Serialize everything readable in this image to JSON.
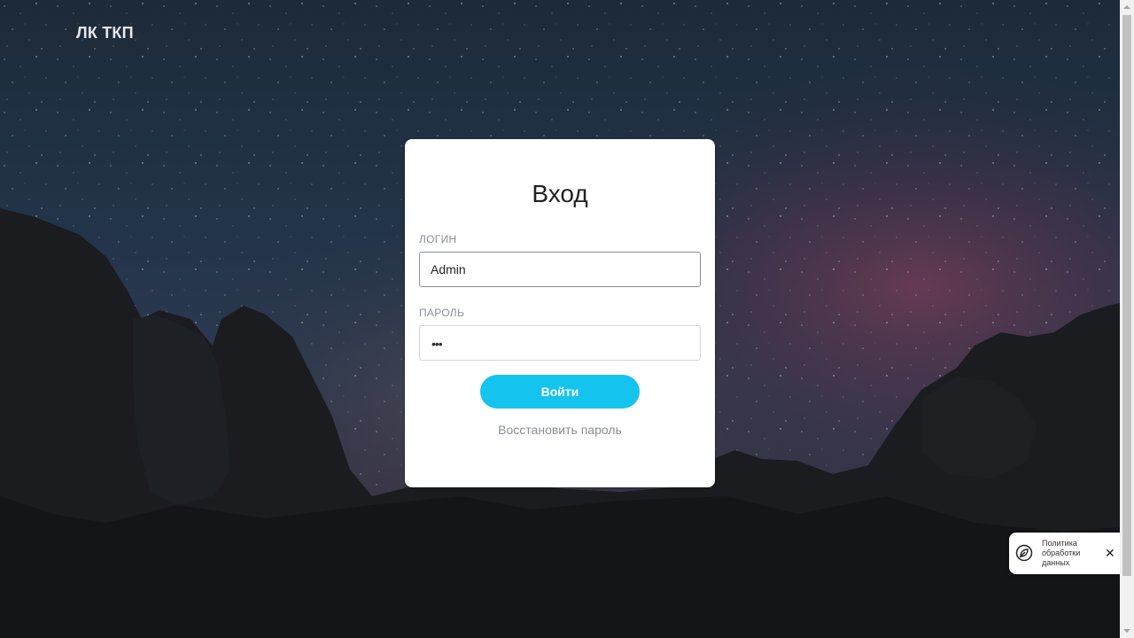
{
  "header": {
    "brand": "ЛК ТКП"
  },
  "login_form": {
    "title": "Вход",
    "login_label": "ЛОГИН",
    "login_value": "Admin",
    "password_label": "ПАРОЛЬ",
    "password_mask": "•••",
    "submit_label": "Войти",
    "restore_label": "Восстановить пароль"
  },
  "policy_popup": {
    "text": "Политика обработки данных",
    "close_glyph": "✕"
  },
  "colors": {
    "accent": "#14c3ee",
    "card_bg": "#ffffff",
    "label_gray": "#8a8f96"
  },
  "icons": {
    "policy": "policy-icon",
    "close": "close-icon"
  }
}
